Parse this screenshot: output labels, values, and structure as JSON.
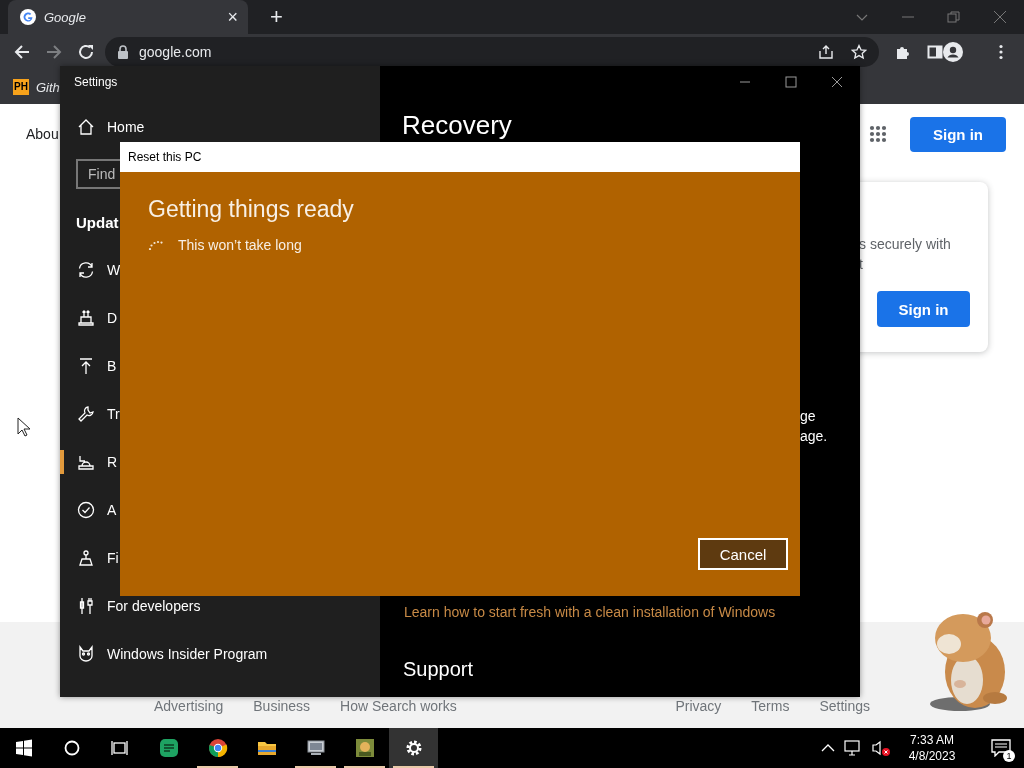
{
  "browser": {
    "tab": {
      "title": "Google",
      "close": "×"
    },
    "new_tab": "+",
    "address": "google.com",
    "forward_disabled": true,
    "bookmarks": [
      {
        "badge": "PH",
        "label": "Gith"
      }
    ]
  },
  "google_page": {
    "header_link": "Abou",
    "sign_in": "Sign in",
    "card": {
      "lines": [
        "s securely with",
        "t"
      ],
      "button": "Sign in"
    },
    "footer_left": [
      "Advertising",
      "Business",
      "How Search works"
    ],
    "footer_right": [
      "Privacy",
      "Terms",
      "Settings"
    ]
  },
  "settings_window": {
    "title": "Settings",
    "sidebar": {
      "home": "Home",
      "search": {
        "placeholder": "Find"
      },
      "section": "Updat",
      "items": [
        {
          "kind": "sync",
          "label": "W",
          "selected": false
        },
        {
          "kind": "delivery",
          "label": "D",
          "selected": false
        },
        {
          "kind": "backup",
          "label": "B",
          "selected": false
        },
        {
          "kind": "wrench",
          "label": "Tr",
          "selected": false
        },
        {
          "kind": "recovery",
          "label": "R",
          "selected": true
        },
        {
          "kind": "check",
          "label": "A",
          "selected": false
        },
        {
          "kind": "find",
          "label": "Fi",
          "selected": false
        },
        {
          "kind": "developers",
          "label": "For developers",
          "selected": false
        },
        {
          "kind": "insider",
          "label": "Windows Insider Program",
          "selected": false
        }
      ]
    },
    "content": {
      "heading": "Recovery",
      "lines": [
        "ge",
        "age."
      ],
      "link": "Learn how to start fresh with a clean installation of Windows",
      "support": "Support"
    }
  },
  "dialog": {
    "title": "Reset this PC",
    "heading": "Getting things ready",
    "status": "This won’t take long",
    "cancel": "Cancel"
  },
  "taskbar": {
    "apps": [
      {
        "kind": "start",
        "running": false,
        "selected": false
      },
      {
        "kind": "search",
        "running": false,
        "selected": false
      },
      {
        "kind": "taskview",
        "running": false,
        "selected": false
      },
      {
        "kind": "sheets",
        "running": false,
        "selected": false
      },
      {
        "kind": "chrome",
        "running": true,
        "selected": false
      },
      {
        "kind": "folder",
        "running": false,
        "selected": false
      },
      {
        "kind": "monitor",
        "running": true,
        "selected": false
      },
      {
        "kind": "game",
        "running": true,
        "selected": false
      },
      {
        "kind": "settings",
        "running": true,
        "selected": true
      }
    ],
    "time": "7:33 AM",
    "date": "4/8/2023",
    "notifications": "1"
  }
}
